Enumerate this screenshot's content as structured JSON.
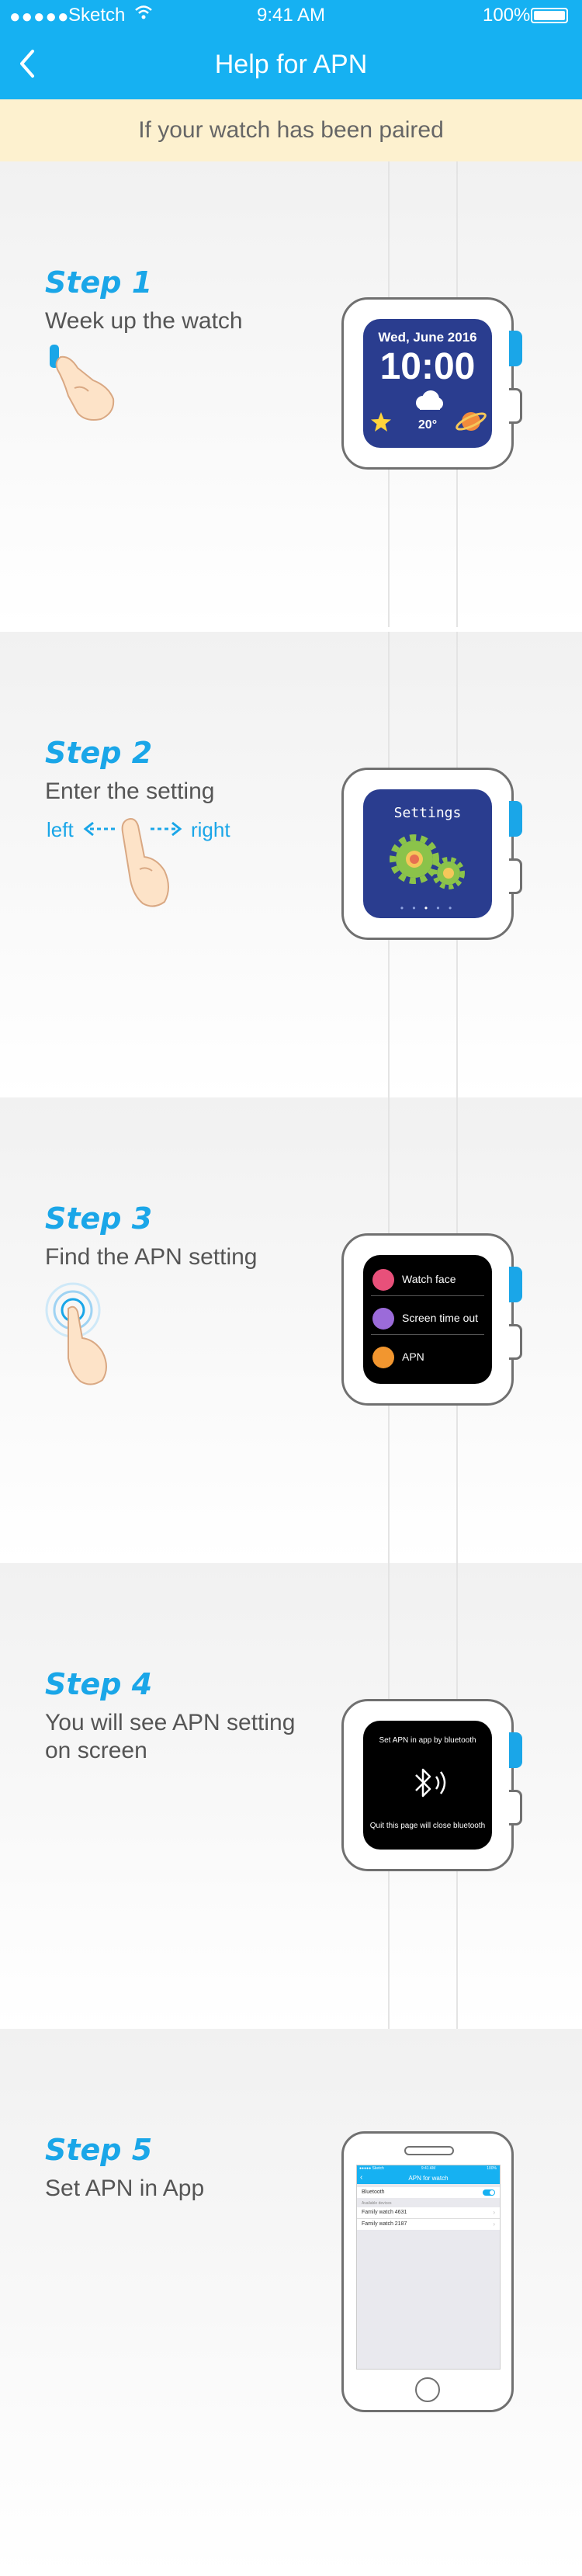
{
  "status_bar": {
    "carrier": "Sketch",
    "time": "9:41 AM",
    "battery": "100%"
  },
  "nav": {
    "title": "Help for APN",
    "back_icon": "chevron-left-icon"
  },
  "banner": {
    "text": "If your watch has been paired"
  },
  "colors": {
    "brand": "#16b1f2",
    "accent": "#1aa6e8",
    "banner_bg": "#fdf1cf",
    "watch_screen": "#2a3d8f"
  },
  "steps": [
    {
      "title": "Step 1",
      "desc": "Week up the watch",
      "screen": {
        "date": "Wed, June 2016",
        "time": "10:00",
        "temp": "20°"
      }
    },
    {
      "title": "Step 2",
      "desc": "Enter the setting",
      "swipe": {
        "left": "left",
        "right": "right"
      },
      "screen": {
        "title": "Settings"
      }
    },
    {
      "title": "Step 3",
      "desc": "Find the APN setting",
      "menu": [
        {
          "label": "Watch face",
          "icon": "watch-face-icon",
          "color": "#e8507a"
        },
        {
          "label": "Screen time out",
          "icon": "moon-icon",
          "color": "#9b6bd9"
        },
        {
          "label": "APN",
          "icon": "signal-bars-icon",
          "color": "#f2962f"
        }
      ]
    },
    {
      "title": "Step 4",
      "desc": "You will see APN setting on screen",
      "screen": {
        "top": "Set APN in app by bluetooth",
        "bottom": "Quit this page will close bluetooth"
      }
    },
    {
      "title": "Step 5",
      "desc": "Set APN in App",
      "phone": {
        "status_left": "●●●●● Sketch",
        "status_time": "9:41 AM",
        "status_right": "100%",
        "title": "APN for watch",
        "bluetooth_label": "Bluetooth",
        "section_label": "Available devices",
        "devices": [
          "Family watch 4631",
          "Family watch 2187"
        ]
      }
    }
  ]
}
